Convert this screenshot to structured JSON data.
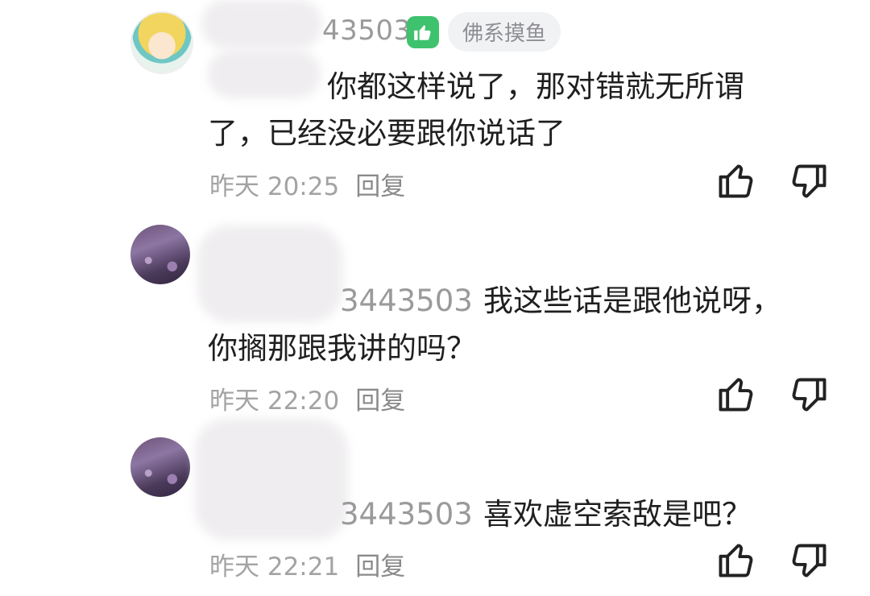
{
  "comments": [
    {
      "user_id_visible": "43503",
      "tag": "佛系摸鱼",
      "text_lines": [
        "你都这样说了，那对错就无所谓",
        "了，已经没必要跟你说话了"
      ],
      "time": "昨天 20:25",
      "reply_label": "回复"
    },
    {
      "reply_to_visible": "3443503",
      "text_lines": [
        "我这些话是跟他说呀，",
        "你搁那跟我讲的吗？"
      ],
      "time": "昨天 22:20",
      "reply_label": "回复"
    },
    {
      "reply_to_visible": "3443503",
      "text_lines": [
        "喜欢虚空索敌是吧？"
      ],
      "time": "昨天 22:21",
      "reply_label": "回复"
    }
  ],
  "icons": {
    "like": "thumbs-up-icon",
    "dislike": "thumbs-down-icon",
    "badge": "thumbs-up-badge-icon"
  },
  "colors": {
    "badge": "#3ec26e",
    "meta": "#a3a3a3",
    "tag_bg": "#f1f2f4"
  }
}
